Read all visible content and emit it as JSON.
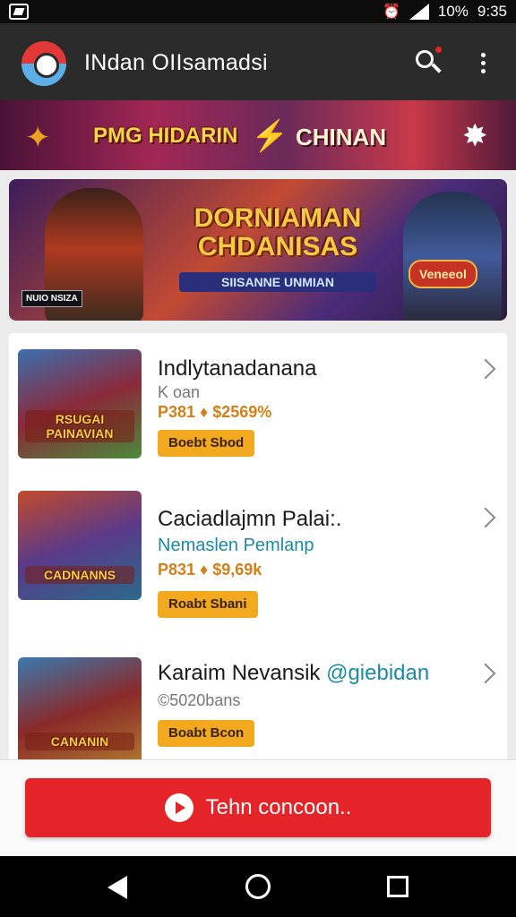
{
  "status_bar": {
    "battery": "10%",
    "time": "9:35"
  },
  "app_bar": {
    "title": "INdan OIIsamadsi"
  },
  "promo_strip": {
    "left_text": "PMG HIDARIN",
    "right_text": "CHINAN"
  },
  "hero_banner": {
    "title": "DORNIAMAN CHDANISAS",
    "subtitle": "SIISANNE UNMIAN",
    "tag": "Veneeol",
    "mini_label": "NUIO NSIZA"
  },
  "games": [
    {
      "name": "Indlytanadanana",
      "sub": "K oan",
      "stats": "P381 ♦ $2569%",
      "button": "Boebt Sbod",
      "thumb_caption": "RSUGAI PAINAVIAN",
      "sub_style": "grey"
    },
    {
      "name": "Caciadlajmn Palai:.",
      "sub": "Nemaslen Pemlanp",
      "stats": "P831 ♦ $9,69k",
      "button": "Roabt Sbani",
      "thumb_caption": "CADNANNS",
      "sub_style": "teal"
    },
    {
      "name": "Karaim Nevansik",
      "handle": "@giebidan",
      "sub": "©5020bans",
      "stats": "",
      "button": "Boabt Bcon",
      "thumb_caption": "CANANIN",
      "sub_style": "grey"
    }
  ],
  "cta": {
    "label": "Tehn concoon.."
  },
  "colors": {
    "accent": "#e42428",
    "button": "#f2a81f",
    "app_bar": "#2b2b2b"
  },
  "icons": [
    "app-icon",
    "signal-icon",
    "alarm-icon",
    "search-icon",
    "more-vert-icon",
    "flame-icon",
    "lightning-icon",
    "star-icon",
    "chevron-right-icon",
    "play-icon",
    "nav-back-icon",
    "nav-home-icon",
    "nav-recent-icon"
  ]
}
